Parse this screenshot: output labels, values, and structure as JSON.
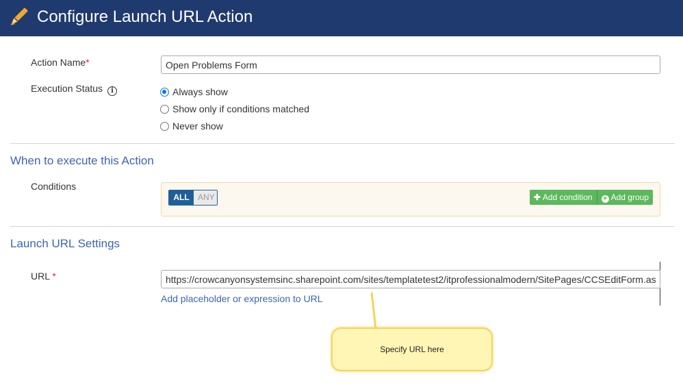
{
  "header": {
    "title": "Configure Launch URL Action",
    "icon": "pencil-icon"
  },
  "form": {
    "action_name_label": "Action Name",
    "required_mark": "*",
    "action_name_value": "Open Problems Form",
    "execution_status_label": "Execution Status",
    "execution_status_options": [
      {
        "label": "Always show",
        "selected": true
      },
      {
        "label": "Show only if conditions matched",
        "selected": false
      },
      {
        "label": "Never show",
        "selected": false
      }
    ]
  },
  "when_section": {
    "title": "When to execute this Action",
    "conditions_label": "Conditions",
    "toggle": {
      "all": "ALL",
      "any": "ANY",
      "selected": "ALL"
    },
    "add_condition_label": "Add condition",
    "add_group_label": "Add group"
  },
  "launch_section": {
    "title": "Launch URL Settings",
    "url_label": "URL",
    "url_value": "https://crowcanyonsystemsinc.sharepoint.com/sites/templatetest2/itprofessionalmodern/SitePages/CCSEditForm.as",
    "placeholder_link": "Add placeholder or expression to URL"
  },
  "callout": {
    "text": "Specify URL here"
  },
  "colors": {
    "header": "#1f3a6e",
    "accent": "#3b65b3",
    "green": "#5cb85c",
    "callout": "#fff6b5"
  }
}
